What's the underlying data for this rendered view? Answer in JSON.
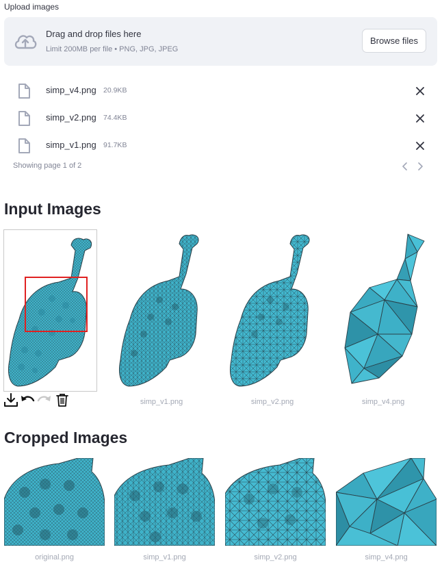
{
  "uploader": {
    "label": "Upload images",
    "dropzone_title": "Drag and drop files here",
    "dropzone_subtitle": "Limit 200MB per file • PNG, JPG, JPEG",
    "browse_label": "Browse files",
    "files": [
      {
        "name": "simp_v4.png",
        "size": "20.9KB"
      },
      {
        "name": "simp_v2.png",
        "size": "74.4KB"
      },
      {
        "name": "simp_v1.png",
        "size": "91.7KB"
      }
    ],
    "page_info": "Showing page 1 of 2"
  },
  "input_section": {
    "heading": "Input Images",
    "captions": [
      "simp_v1.png",
      "simp_v2.png",
      "simp_v4.png"
    ],
    "toolbar_icons": [
      "download-icon",
      "undo-icon",
      "redo-icon",
      "trash-icon"
    ]
  },
  "cropped_section": {
    "heading": "Cropped Images",
    "captions": [
      "original.png",
      "simp_v1.png",
      "simp_v2.png",
      "simp_v4.png"
    ]
  },
  "colors": {
    "mesh_fill": "#3fb2c9",
    "mesh_line": "#2a3f47",
    "crop_box": "#e02020",
    "dropzone_bg": "#f0f2f6"
  }
}
